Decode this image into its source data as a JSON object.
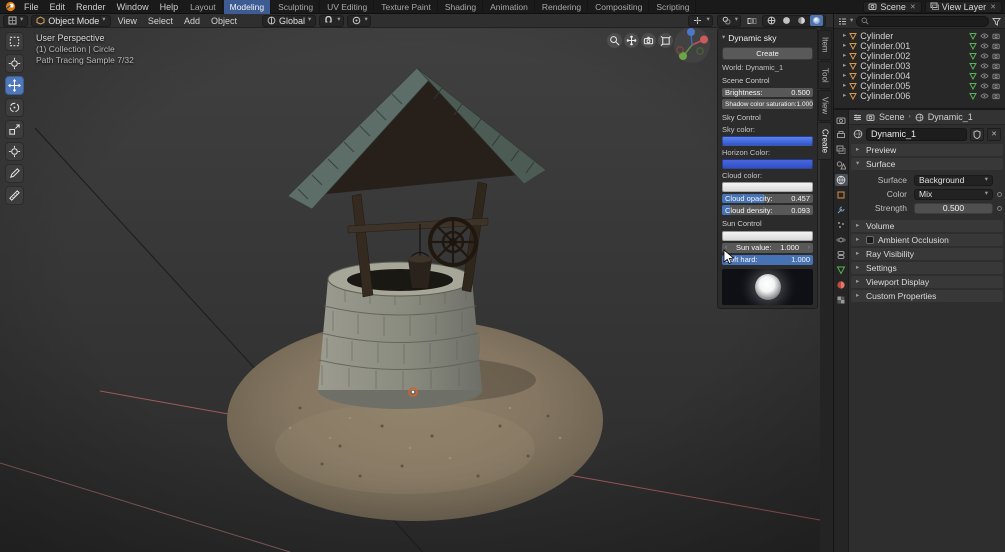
{
  "icons": {
    "caret_down": "▾",
    "caret_right": "▸",
    "chevron_left": "‹",
    "chevron_right": "›",
    "close": "✕",
    "breadcrumb_sep": "›"
  },
  "topbar": {
    "menus": [
      "File",
      "Edit",
      "Render",
      "Window",
      "Help"
    ],
    "workspaces": [
      "Layout",
      "Modeling",
      "Sculpting",
      "UV Editing",
      "Texture Paint",
      "Shading",
      "Animation",
      "Rendering",
      "Compositing",
      "Scripting"
    ],
    "active_workspace": "Modeling",
    "scene": "Scene",
    "view_layer": "View Layer"
  },
  "viewport_header": {
    "mode": "Object Mode",
    "menus": [
      "View",
      "Select",
      "Add",
      "Object"
    ],
    "orientation": "Global"
  },
  "viewport_overlay": {
    "line1": "User Perspective",
    "line2": "(1) Collection | Circle",
    "line3": "Path Tracing Sample 7/32"
  },
  "npanel": {
    "title": "Dynamic sky",
    "create": "Create",
    "world": "World: Dynamic_1",
    "scene_control": "Scene Control",
    "brightness_label": "Brightness:",
    "brightness_value": "0.500",
    "shadow_label": "Shadow color saturation:",
    "shadow_value": "1.000",
    "sky_control": "Sky Control",
    "sky_color_label": "Sky color:",
    "horizon_label": "Horizon Color:",
    "cloud_color_label": "Cloud color:",
    "cloud_opacity_label": "Cloud opacity:",
    "cloud_opacity_value": "0.457",
    "cloud_density_label": "Cloud density:",
    "cloud_density_value": "0.093",
    "sun_control": "Sun Control",
    "sun_value_label": "Sun value:",
    "sun_value": "1.000",
    "soft_hard_label": "Soft hard:",
    "soft_hard_value": "1.000"
  },
  "side_tabs": [
    "Item",
    "Tool",
    "View",
    "Create"
  ],
  "outliner": {
    "items": [
      {
        "name": "Cylinder"
      },
      {
        "name": "Cylinder.001"
      },
      {
        "name": "Cylinder.002"
      },
      {
        "name": "Cylinder.003"
      },
      {
        "name": "Cylinder.004"
      },
      {
        "name": "Cylinder.005"
      },
      {
        "name": "Cylinder.006"
      }
    ]
  },
  "properties": {
    "breadcrumb": {
      "scene": "Scene",
      "world": "Dynamic_1"
    },
    "id_name": "Dynamic_1",
    "panels": {
      "preview": "Preview",
      "surface": "Surface",
      "volume": "Volume",
      "ao": "Ambient Occlusion",
      "ray": "Ray Visibility",
      "settings": "Settings",
      "viewport_display": "Viewport Display",
      "custom": "Custom Properties"
    },
    "surface": {
      "surface_label": "Surface",
      "surface_value": "Background",
      "color_label": "Color",
      "color_value": "Mix",
      "strength_label": "Strength",
      "strength_value": "0.500"
    }
  }
}
